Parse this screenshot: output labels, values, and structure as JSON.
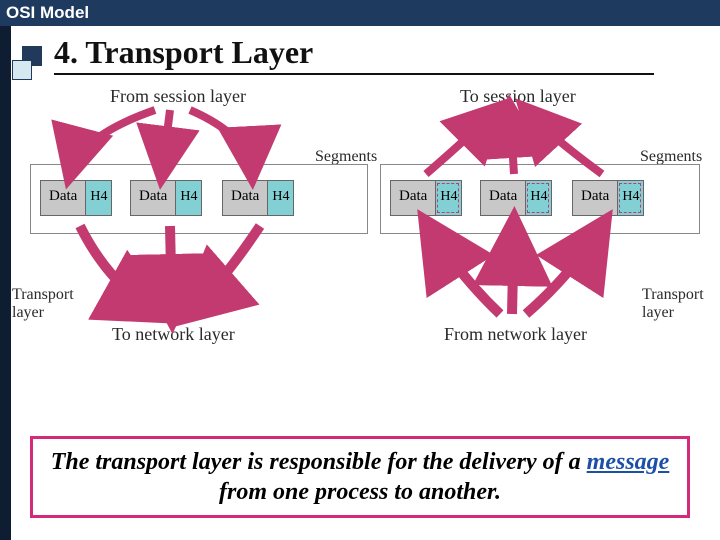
{
  "titlebar": "OSI Model",
  "heading": "4. Transport Layer",
  "labels": {
    "from_session": "From session layer",
    "to_session": "To session layer",
    "segments": "Segments",
    "transport_layer": "Transport\nlayer",
    "to_network": "To network layer",
    "from_network": "From network layer"
  },
  "segment": {
    "data": "Data",
    "header": "H4"
  },
  "note": {
    "pre": "The transport layer is responsible for the delivery of a ",
    "keyword": "message",
    "post": " from one process to another."
  }
}
